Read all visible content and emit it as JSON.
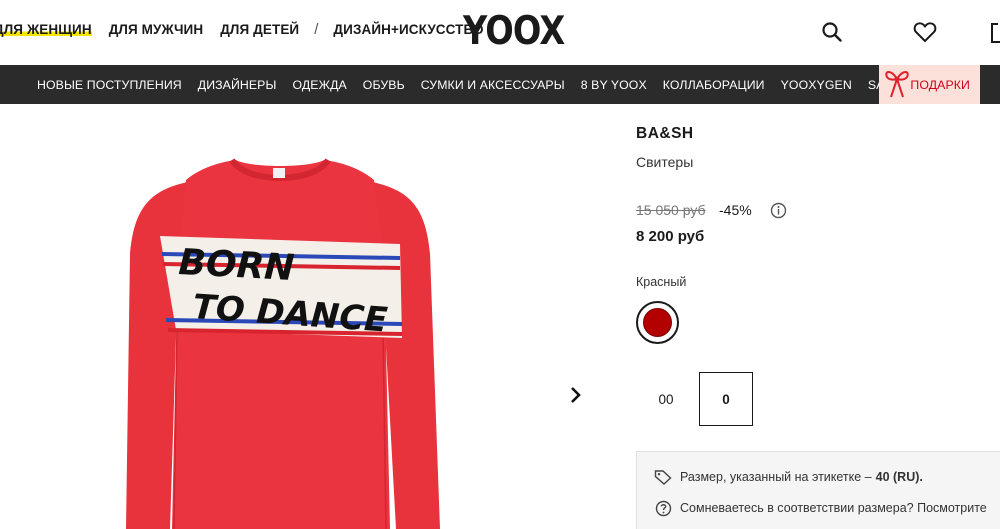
{
  "header": {
    "gender_nav": [
      "ДЛЯ ЖЕНЩИН",
      "ДЛЯ МУЖЧИН",
      "ДЛЯ ДЕТЕЙ",
      "ДИЗАЙН+ИСКУССТВО"
    ],
    "separator": "/",
    "logo": "YOOX",
    "icons": [
      "search-icon",
      "heart-icon",
      "bag-icon"
    ]
  },
  "category_nav": {
    "items": [
      "НОВЫЕ ПОСТУПЛЕНИЯ",
      "ДИЗАЙНЕРЫ",
      "ОДЕЖДА",
      "ОБУВЬ",
      "СУМКИ И АКСЕССУАРЫ",
      "8 BY YOOX",
      "КОЛЛАБОРАЦИИ",
      "YOOXYGEN",
      "SALE"
    ],
    "gifts_label": "ПОДАРКИ",
    "gifts_color": "#d0021b"
  },
  "product": {
    "print_line1": "BORN",
    "print_line2": "TO DANCE",
    "sweater_color": "#e8323c",
    "brand": "BA&SH",
    "category": "Свитеры",
    "old_price": "15 050 руб",
    "discount": "-45%",
    "price": "8 200 руб",
    "color_name": "Красный",
    "swatch_color": "#b30000",
    "sizes": [
      {
        "label": "00",
        "selected": false
      },
      {
        "label": "0",
        "selected": true
      }
    ],
    "size_info": {
      "label_text": "Размер, указанный на этикетке –",
      "label_value": "40 (RU).",
      "doubt_text": "Сомневаетесь в соответствии размера? Посмотрите"
    }
  }
}
